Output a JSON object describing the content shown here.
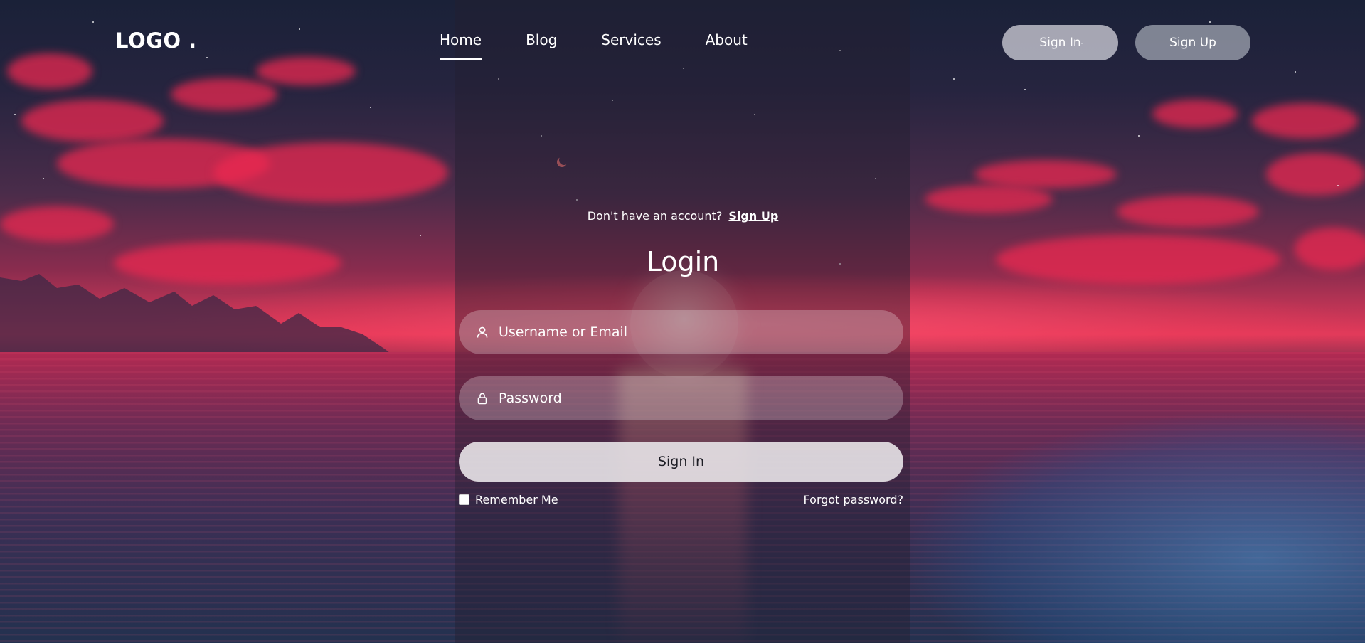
{
  "header": {
    "logo": "LOGO .",
    "nav": [
      {
        "label": "Home",
        "active": true
      },
      {
        "label": "Blog",
        "active": false
      },
      {
        "label": "Services",
        "active": false
      },
      {
        "label": "About",
        "active": false
      }
    ],
    "signin_label": "Sign In",
    "signup_label": "Sign Up"
  },
  "form": {
    "account_prompt": "Don't have an account?",
    "account_link": "Sign Up",
    "title": "Login",
    "username": {
      "placeholder": "Username or Email",
      "value": "",
      "icon": "user-icon"
    },
    "password": {
      "placeholder": "Password",
      "value": "",
      "icon": "lock-icon"
    },
    "submit_label": "Sign In",
    "remember_label": "Remember Me",
    "remember_checked": false,
    "forgot_label": "Forgot password?"
  },
  "colors": {
    "text": "#ffffff",
    "submit_text": "#1c1c24",
    "sky_top": "#1a2138",
    "horizon": "#e23a5a"
  }
}
